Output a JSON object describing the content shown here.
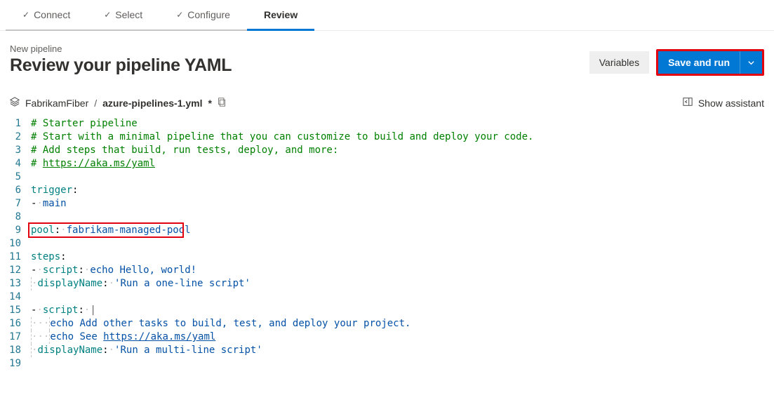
{
  "tabs": {
    "connect": "Connect",
    "select": "Select",
    "configure": "Configure",
    "review": "Review"
  },
  "header": {
    "subtitle": "New pipeline",
    "title": "Review your pipeline YAML",
    "variables_label": "Variables",
    "save_run_label": "Save and run"
  },
  "file": {
    "repo": "FabrikamFiber",
    "separator": "/",
    "name": "azure-pipelines-1.yml",
    "dirty_marker": "*",
    "show_assistant": "Show assistant"
  },
  "editor": {
    "lines": [
      {
        "n": 1,
        "type": "comment",
        "text": "# Starter pipeline"
      },
      {
        "n": 2,
        "type": "comment",
        "text": "# Start with a minimal pipeline that you can customize to build and deploy your code."
      },
      {
        "n": 3,
        "type": "comment",
        "text": "# Add steps that build, run tests, deploy, and more:"
      },
      {
        "n": 4,
        "type": "comment-url",
        "prefix": "# ",
        "url": "https://aka.ms/yaml"
      },
      {
        "n": 5,
        "type": "blank"
      },
      {
        "n": 6,
        "type": "key-only",
        "key": "trigger",
        "after": ":"
      },
      {
        "n": 7,
        "type": "list-item",
        "value": "main"
      },
      {
        "n": 8,
        "type": "blank"
      },
      {
        "n": 9,
        "type": "kv",
        "key": "pool",
        "value": "fabrikam-managed-pool",
        "boxed": true
      },
      {
        "n": 10,
        "type": "blank"
      },
      {
        "n": 11,
        "type": "key-only",
        "key": "steps",
        "after": ":"
      },
      {
        "n": 12,
        "type": "script",
        "value": "echo Hello, world!"
      },
      {
        "n": 13,
        "type": "display",
        "value": "'Run a one-line script'"
      },
      {
        "n": 14,
        "type": "blank"
      },
      {
        "n": 15,
        "type": "script-pipe"
      },
      {
        "n": 16,
        "type": "echo-line",
        "text": "echo Add other tasks to build, test, and deploy your project."
      },
      {
        "n": 17,
        "type": "echo-url",
        "prefix": "echo See ",
        "url": "https://aka.ms/yaml"
      },
      {
        "n": 18,
        "type": "display",
        "value": "'Run a multi-line script'"
      },
      {
        "n": 19,
        "type": "blank"
      }
    ]
  }
}
